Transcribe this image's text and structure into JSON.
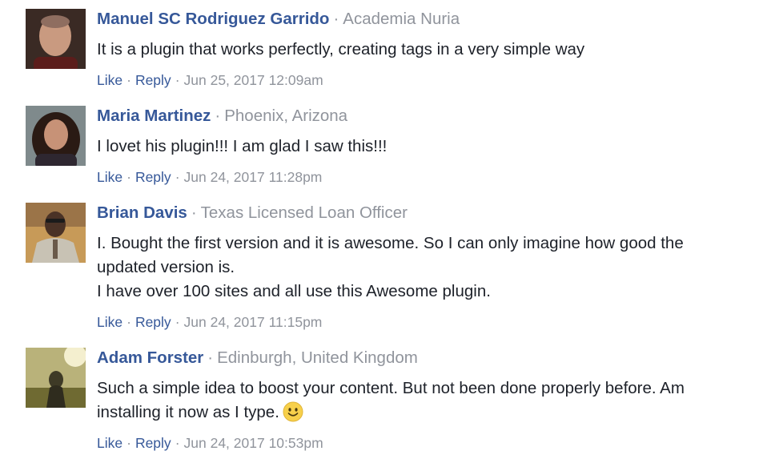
{
  "comments": [
    {
      "name": "Manuel SC Rodriguez Garrido",
      "affiliation": "Academia Nuria",
      "text_lines": [
        "It is a plugin that works perfectly, creating tags in a very simple way"
      ],
      "like_label": "Like",
      "reply_label": "Reply",
      "timestamp": "Jun 25, 2017 12:09am"
    },
    {
      "name": "Maria Martinez",
      "affiliation": "Phoenix, Arizona",
      "text_lines": [
        "I lovet his plugin!!! I am glad I saw this!!!"
      ],
      "like_label": "Like",
      "reply_label": "Reply",
      "timestamp": "Jun 24, 2017 11:28pm"
    },
    {
      "name": "Brian Davis",
      "affiliation": "Texas Licensed Loan Officer",
      "text_lines": [
        "I. Bought the first version and it is awesome. So I can only imagine how good the",
        "updated version is.",
        "I have over 100 sites and all use this Awesome plugin."
      ],
      "like_label": "Like",
      "reply_label": "Reply",
      "timestamp": "Jun 24, 2017 11:15pm"
    },
    {
      "name": "Adam Forster",
      "affiliation": "Edinburgh, United Kingdom",
      "text_lines": [
        "Such a simple idea to boost your content. But not been done properly before. Am",
        "installing it now as I type."
      ],
      "emoji": "smiley-emoji",
      "like_label": "Like",
      "reply_label": "Reply",
      "timestamp": "Jun 24, 2017 10:53pm"
    }
  ],
  "colors": {
    "name_link": "#365899",
    "meta_gray": "#90949c",
    "text": "#1d2129"
  }
}
